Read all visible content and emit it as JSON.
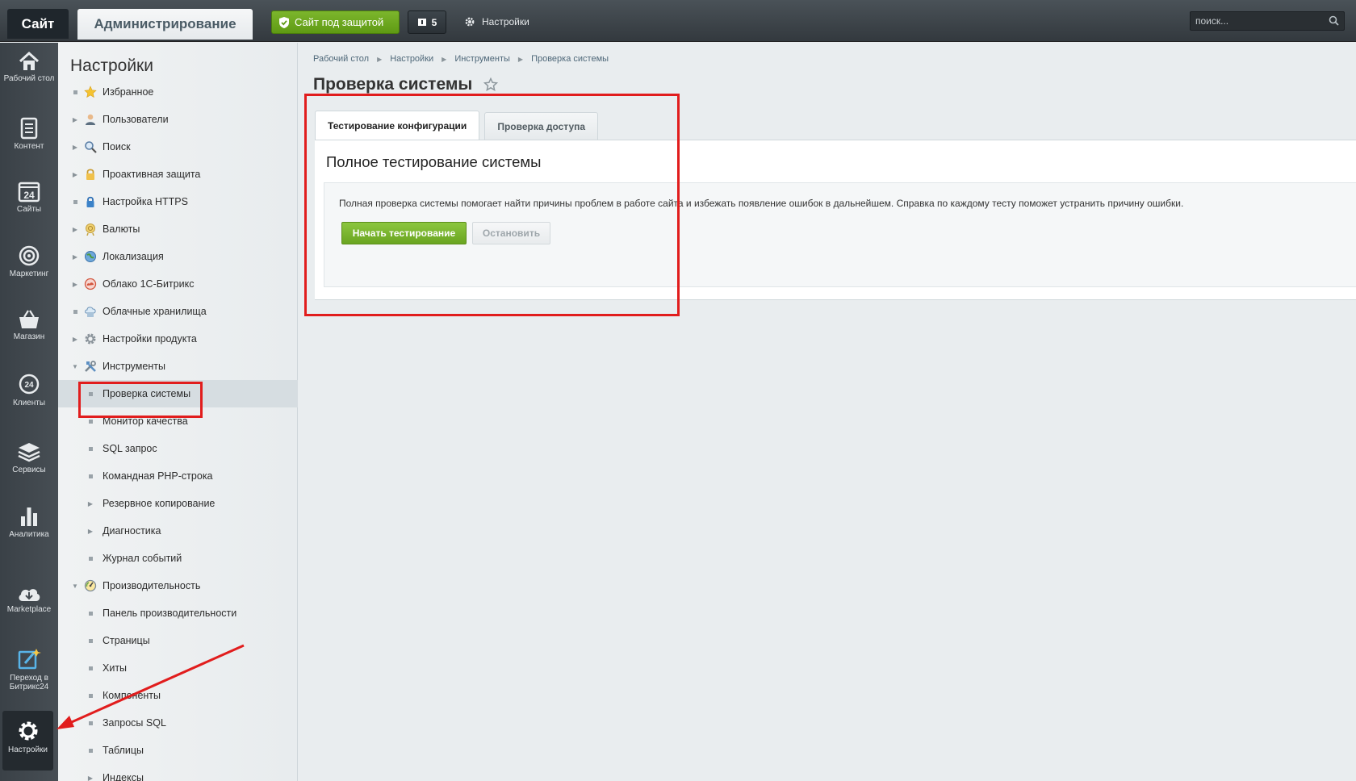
{
  "topbar": {
    "site_tab": "Сайт",
    "admin_tab": "Администрирование",
    "secure_button": "Сайт под защитой",
    "updates_count": "5",
    "settings_link": "Настройки",
    "search_placeholder": "поиск..."
  },
  "rail": [
    {
      "label": "Рабочий стол",
      "icon": "home-icon"
    },
    {
      "label": "Контент",
      "icon": "document-icon"
    },
    {
      "label": "Сайты",
      "icon": "calendar-24-icon"
    },
    {
      "label": "Маркетинг",
      "icon": "target-icon"
    },
    {
      "label": "Магазин",
      "icon": "basket-icon"
    },
    {
      "label": "Клиенты",
      "icon": "bubble-24-icon"
    },
    {
      "label": "Сервисы",
      "icon": "layers-icon"
    },
    {
      "label": "Аналитика",
      "icon": "bar-chart-icon"
    },
    {
      "label": "Marketplace",
      "icon": "cloud-download-icon"
    },
    {
      "label": "Переход в Битрикс24",
      "icon": "external-edit-icon"
    },
    {
      "label": "Настройки",
      "icon": "gear-icon",
      "active": true
    }
  ],
  "menu": {
    "title": "Настройки",
    "items": [
      {
        "label": "Избранное",
        "level": 0,
        "arrow": "dot",
        "icon": "star-icon"
      },
      {
        "label": "Пользователи",
        "level": 0,
        "arrow": "right",
        "icon": "user-icon"
      },
      {
        "label": "Поиск",
        "level": 0,
        "arrow": "right",
        "icon": "magnifier-icon"
      },
      {
        "label": "Проактивная защита",
        "level": 0,
        "arrow": "right",
        "icon": "lock-icon"
      },
      {
        "label": "Настройка HTTPS",
        "level": 0,
        "arrow": "dot",
        "icon": "https-lock-icon"
      },
      {
        "label": "Валюты",
        "level": 0,
        "arrow": "right",
        "icon": "currency-icon"
      },
      {
        "label": "Локализация",
        "level": 0,
        "arrow": "right",
        "icon": "globe-icon"
      },
      {
        "label": "Облако 1С-Битрикс",
        "level": 0,
        "arrow": "right",
        "icon": "cloud-icon"
      },
      {
        "label": "Облачные хранилища",
        "level": 0,
        "arrow": "dot",
        "icon": "storage-icon"
      },
      {
        "label": "Настройки продукта",
        "level": 0,
        "arrow": "right",
        "icon": "cog-icon"
      },
      {
        "label": "Инструменты",
        "level": 0,
        "arrow": "down",
        "icon": "tools-icon"
      },
      {
        "label": "Проверка системы",
        "level": 1,
        "arrow": "dot",
        "selected": true
      },
      {
        "label": "Монитор качества",
        "level": 1,
        "arrow": "dot"
      },
      {
        "label": "SQL запрос",
        "level": 1,
        "arrow": "dot"
      },
      {
        "label": "Командная PHP-строка",
        "level": 1,
        "arrow": "dot"
      },
      {
        "label": "Резервное копирование",
        "level": 1,
        "arrow": "right"
      },
      {
        "label": "Диагностика",
        "level": 1,
        "arrow": "right"
      },
      {
        "label": "Журнал событий",
        "level": 1,
        "arrow": "dot"
      },
      {
        "label": "Производительность",
        "level": 0,
        "arrow": "down",
        "icon": "speedometer-icon"
      },
      {
        "label": "Панель производительности",
        "level": 1,
        "arrow": "dot"
      },
      {
        "label": "Страницы",
        "level": 1,
        "arrow": "dot"
      },
      {
        "label": "Хиты",
        "level": 1,
        "arrow": "dot"
      },
      {
        "label": "Компоненты",
        "level": 1,
        "arrow": "dot"
      },
      {
        "label": "Запросы SQL",
        "level": 1,
        "arrow": "dot"
      },
      {
        "label": "Таблицы",
        "level": 1,
        "arrow": "dot"
      },
      {
        "label": "Индексы",
        "level": 1,
        "arrow": "right"
      }
    ]
  },
  "content": {
    "breadcrumbs": [
      "Рабочий стол",
      "Настройки",
      "Инструменты",
      "Проверка системы"
    ],
    "page_title": "Проверка системы",
    "tabs": [
      {
        "label": "Тестирование конфигурации",
        "active": true
      },
      {
        "label": "Проверка доступа",
        "active": false
      }
    ],
    "panel_title": "Полное тестирование системы",
    "panel_description": "Полная проверка системы помогает найти причины проблем в работе сайта и избежать появление ошибок в дальнейшем. Справка по каждому тесту поможет устранить причину ошибки.",
    "start_button": "Начать тестирование",
    "stop_button": "Остановить"
  },
  "colors": {
    "annotation": "#e11d1d",
    "start_button": "#7ab530",
    "secure_button": "#6ea820",
    "rail_background": "#3f464c"
  }
}
